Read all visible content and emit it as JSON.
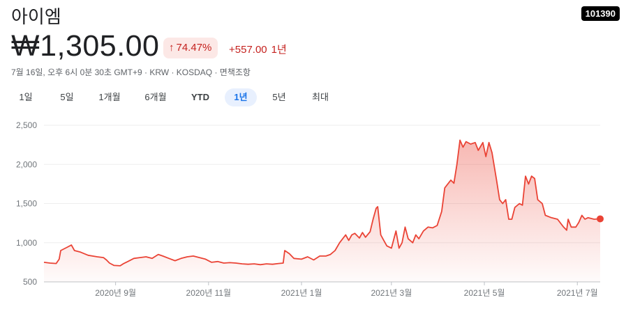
{
  "header": {
    "name": "아이엠",
    "ticker": "101390",
    "price": "₩1,305.00",
    "change_pct": "74.47%",
    "change_arrow": "↑",
    "change_abs": "+557.00",
    "change_period": "1년",
    "meta": "7월 16일, 오후 6시 0분 30초 GMT+9 · KRW · KOSDAQ · 면책조항"
  },
  "tabs": [
    "1일",
    "5일",
    "1개월",
    "6개월",
    "YTD",
    "1년",
    "5년",
    "최대"
  ],
  "active_tab": "1년",
  "colors": {
    "line": "#ea4335",
    "fill": "#ea4335",
    "down": "#c5221f",
    "badge_bg": "#fce8e6",
    "active_tab_bg": "#e8f0fe",
    "active_tab_text": "#1a73e8"
  },
  "chart_data": {
    "type": "area",
    "ylim": [
      500,
      2500
    ],
    "yticks": [
      500,
      1000,
      1500,
      2000,
      2500
    ],
    "ytick_labels": [
      "500",
      "1,000",
      "1,500",
      "2,000",
      "2,500"
    ],
    "xlim": [
      "2020-07-16",
      "2021-07-16"
    ],
    "xticks": [
      "2020-09-01",
      "2020-11-01",
      "2021-01-01",
      "2021-03-01",
      "2021-05-01",
      "2021-07-01"
    ],
    "xtick_labels": [
      "2020년 9월",
      "2020년 11월",
      "2021년 1월",
      "2021년 3월",
      "2021년 5월",
      "2021년 7월"
    ],
    "grid": true,
    "series": [
      {
        "points": [
          [
            "2020-07-16",
            750
          ],
          [
            "2020-07-20",
            740
          ],
          [
            "2020-07-24",
            735
          ],
          [
            "2020-07-26",
            790
          ],
          [
            "2020-07-27",
            900
          ],
          [
            "2020-07-31",
            940
          ],
          [
            "2020-08-03",
            970
          ],
          [
            "2020-08-05",
            900
          ],
          [
            "2020-08-09",
            880
          ],
          [
            "2020-08-14",
            840
          ],
          [
            "2020-08-20",
            820
          ],
          [
            "2020-08-24",
            810
          ],
          [
            "2020-08-26",
            780
          ],
          [
            "2020-08-28",
            740
          ],
          [
            "2020-08-31",
            710
          ],
          [
            "2020-09-04",
            705
          ],
          [
            "2020-09-06",
            730
          ],
          [
            "2020-09-09",
            760
          ],
          [
            "2020-09-13",
            800
          ],
          [
            "2020-09-17",
            810
          ],
          [
            "2020-09-21",
            820
          ],
          [
            "2020-09-25",
            800
          ],
          [
            "2020-09-29",
            850
          ],
          [
            "2020-10-02",
            830
          ],
          [
            "2020-10-06",
            800
          ],
          [
            "2020-10-10",
            770
          ],
          [
            "2020-10-14",
            800
          ],
          [
            "2020-10-18",
            820
          ],
          [
            "2020-10-22",
            830
          ],
          [
            "2020-10-26",
            810
          ],
          [
            "2020-10-30",
            790
          ],
          [
            "2020-11-03",
            750
          ],
          [
            "2020-11-07",
            760
          ],
          [
            "2020-11-11",
            740
          ],
          [
            "2020-11-15",
            745
          ],
          [
            "2020-11-19",
            740
          ],
          [
            "2020-11-23",
            730
          ],
          [
            "2020-11-27",
            725
          ],
          [
            "2020-12-01",
            730
          ],
          [
            "2020-12-05",
            720
          ],
          [
            "2020-12-09",
            730
          ],
          [
            "2020-12-13",
            725
          ],
          [
            "2020-12-17",
            735
          ],
          [
            "2020-12-20",
            740
          ],
          [
            "2020-12-21",
            900
          ],
          [
            "2020-12-24",
            860
          ],
          [
            "2020-12-27",
            800
          ],
          [
            "2021-01-01",
            790
          ],
          [
            "2021-01-05",
            820
          ],
          [
            "2021-01-09",
            780
          ],
          [
            "2021-01-13",
            830
          ],
          [
            "2021-01-17",
            830
          ],
          [
            "2021-01-20",
            850
          ],
          [
            "2021-01-23",
            900
          ],
          [
            "2021-01-26",
            1000
          ],
          [
            "2021-01-28",
            1050
          ],
          [
            "2021-01-30",
            1100
          ],
          [
            "2021-02-01",
            1030
          ],
          [
            "2021-02-03",
            1100
          ],
          [
            "2021-02-05",
            1120
          ],
          [
            "2021-02-08",
            1060
          ],
          [
            "2021-02-10",
            1130
          ],
          [
            "2021-02-12",
            1070
          ],
          [
            "2021-02-15",
            1140
          ],
          [
            "2021-02-17",
            1300
          ],
          [
            "2021-02-19",
            1440
          ],
          [
            "2021-02-20",
            1460
          ],
          [
            "2021-02-22",
            1100
          ],
          [
            "2021-02-24",
            1030
          ],
          [
            "2021-02-26",
            960
          ],
          [
            "2021-03-01",
            930
          ],
          [
            "2021-03-04",
            1150
          ],
          [
            "2021-03-06",
            930
          ],
          [
            "2021-03-08",
            1000
          ],
          [
            "2021-03-10",
            1200
          ],
          [
            "2021-03-12",
            1050
          ],
          [
            "2021-03-15",
            1000
          ],
          [
            "2021-03-17",
            1100
          ],
          [
            "2021-03-19",
            1050
          ],
          [
            "2021-03-22",
            1150
          ],
          [
            "2021-03-25",
            1200
          ],
          [
            "2021-03-28",
            1190
          ],
          [
            "2021-03-31",
            1220
          ],
          [
            "2021-04-03",
            1400
          ],
          [
            "2021-04-05",
            1700
          ],
          [
            "2021-04-07",
            1750
          ],
          [
            "2021-04-09",
            1800
          ],
          [
            "2021-04-11",
            1760
          ],
          [
            "2021-04-13",
            2000
          ],
          [
            "2021-04-15",
            2310
          ],
          [
            "2021-04-17",
            2220
          ],
          [
            "2021-04-19",
            2290
          ],
          [
            "2021-04-22",
            2260
          ],
          [
            "2021-04-25",
            2280
          ],
          [
            "2021-04-27",
            2180
          ],
          [
            "2021-04-30",
            2280
          ],
          [
            "2021-05-02",
            2100
          ],
          [
            "2021-05-04",
            2280
          ],
          [
            "2021-05-06",
            2150
          ],
          [
            "2021-05-09",
            1800
          ],
          [
            "2021-05-11",
            1550
          ],
          [
            "2021-05-13",
            1500
          ],
          [
            "2021-05-15",
            1550
          ],
          [
            "2021-05-17",
            1300
          ],
          [
            "2021-05-19",
            1300
          ],
          [
            "2021-05-21",
            1450
          ],
          [
            "2021-05-24",
            1500
          ],
          [
            "2021-05-26",
            1480
          ],
          [
            "2021-05-28",
            1850
          ],
          [
            "2021-05-30",
            1750
          ],
          [
            "2021-06-01",
            1850
          ],
          [
            "2021-06-03",
            1820
          ],
          [
            "2021-06-05",
            1550
          ],
          [
            "2021-06-08",
            1500
          ],
          [
            "2021-06-10",
            1350
          ],
          [
            "2021-06-14",
            1320
          ],
          [
            "2021-06-18",
            1300
          ],
          [
            "2021-06-22",
            1200
          ],
          [
            "2021-06-24",
            1160
          ],
          [
            "2021-06-25",
            1300
          ],
          [
            "2021-06-27",
            1200
          ],
          [
            "2021-06-30",
            1200
          ],
          [
            "2021-07-02",
            1260
          ],
          [
            "2021-07-04",
            1350
          ],
          [
            "2021-07-06",
            1300
          ],
          [
            "2021-07-08",
            1320
          ],
          [
            "2021-07-12",
            1300
          ],
          [
            "2021-07-16",
            1305
          ]
        ]
      }
    ]
  }
}
